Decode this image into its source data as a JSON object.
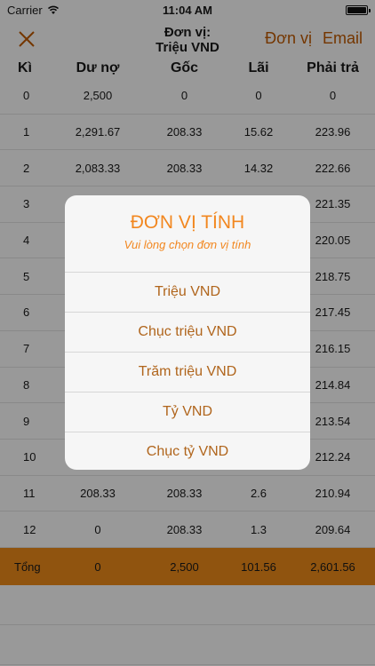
{
  "status": {
    "carrier": "Carrier",
    "time": "11:04 AM"
  },
  "nav": {
    "title_line1": "Đơn vị:",
    "title_line2": "Triệu VND",
    "unit_label": "Đơn vị",
    "email_label": "Email"
  },
  "table": {
    "headers": [
      "Kì",
      "Dư nợ",
      "Gốc",
      "Lãi",
      "Phải trả"
    ],
    "rows": [
      [
        "0",
        "2,500",
        "0",
        "0",
        "0"
      ],
      [
        "1",
        "2,291.67",
        "208.33",
        "15.62",
        "223.96"
      ],
      [
        "2",
        "2,083.33",
        "208.33",
        "14.32",
        "222.66"
      ],
      [
        "3",
        "",
        "",
        "",
        "221.35"
      ],
      [
        "4",
        "",
        "",
        "",
        "220.05"
      ],
      [
        "5",
        "",
        "",
        "",
        "218.75"
      ],
      [
        "6",
        "",
        "",
        "",
        "217.45"
      ],
      [
        "7",
        "",
        "",
        "",
        "216.15"
      ],
      [
        "8",
        "",
        "",
        "",
        "214.84"
      ],
      [
        "9",
        "",
        "",
        "",
        "213.54"
      ],
      [
        "10",
        "",
        "",
        "",
        "212.24"
      ],
      [
        "11",
        "208.33",
        "208.33",
        "2.6",
        "210.94"
      ],
      [
        "12",
        "0",
        "208.33",
        "1.3",
        "209.64"
      ]
    ],
    "total": [
      "Tổng",
      "0",
      "2,500",
      "101.56",
      "2,601.56"
    ]
  },
  "modal": {
    "title": "ĐƠN VỊ TÍNH",
    "subtitle": "Vui lòng chọn đơn vị tính",
    "options": [
      "Triệu VND",
      "Chục triệu VND",
      "Trăm triệu VND",
      "Tỷ VND",
      "Chục tỷ VND"
    ]
  },
  "colors": {
    "accent": "#f2871f",
    "total_bg": "#f08c1a",
    "nav_accent": "#c25b00"
  }
}
